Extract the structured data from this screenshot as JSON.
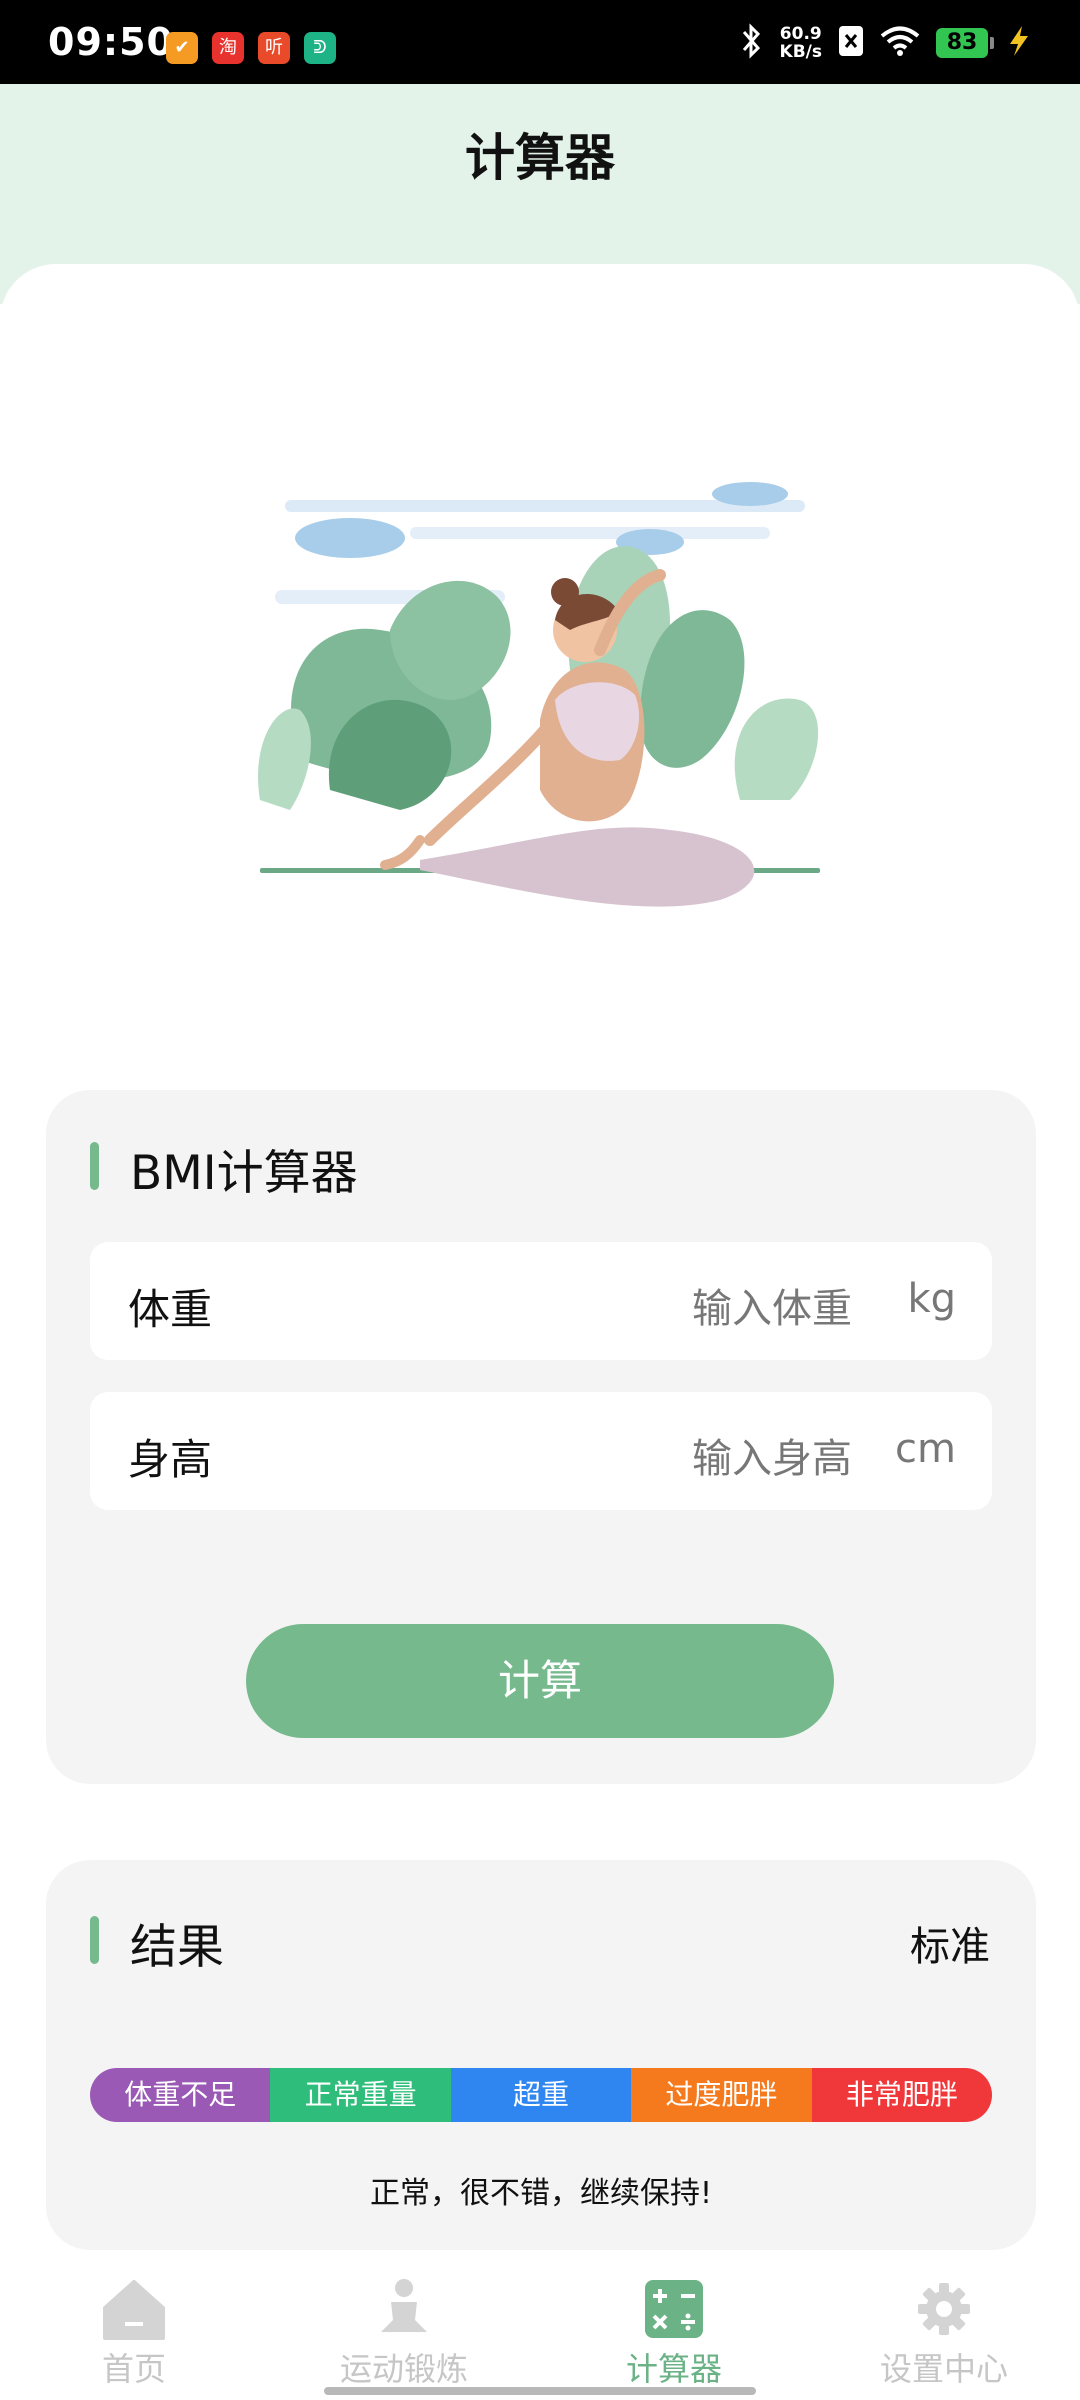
{
  "status_bar": {
    "time": "09:50",
    "net_speed_value": "60.9",
    "net_speed_unit": "KB/s",
    "battery": "83",
    "notifications": [
      "taobao-badge",
      "taobao-icon",
      "ting-icon",
      "mi-icon"
    ],
    "notif_glyphs": [
      "✔",
      "淘",
      "听",
      "ᕲ"
    ]
  },
  "header": {
    "title": "计算器"
  },
  "bmi_card": {
    "title": "BMI计算器",
    "weight": {
      "label": "体重",
      "placeholder": "输入体重",
      "unit": "kg"
    },
    "height": {
      "label": "身高",
      "placeholder": "输入身高",
      "unit": "cm"
    },
    "calculate_label": "计算"
  },
  "result_card": {
    "title": "结果",
    "status": "标准",
    "scale": [
      {
        "label": "体重不足",
        "color": "#9b59b6"
      },
      {
        "label": "正常重量",
        "color": "#2ebd7a"
      },
      {
        "label": "超重",
        "color": "#2f86f0"
      },
      {
        "label": "过度肥胖",
        "color": "#f57a1e"
      },
      {
        "label": "非常肥胖",
        "color": "#f0373a"
      }
    ],
    "advice": "正常，很不错，继续保持!"
  },
  "tabs": [
    {
      "label": "首页",
      "icon": "home-icon",
      "active": false
    },
    {
      "label": "运动锻炼",
      "icon": "yoga-icon",
      "active": false
    },
    {
      "label": "计算器",
      "icon": "calculator-icon",
      "active": true
    },
    {
      "label": "设置中心",
      "icon": "gear-icon",
      "active": false
    }
  ],
  "colors": {
    "accent": "#76b98d",
    "header_bg": "#e3f3ea",
    "card_bg": "#f4f4f4"
  }
}
